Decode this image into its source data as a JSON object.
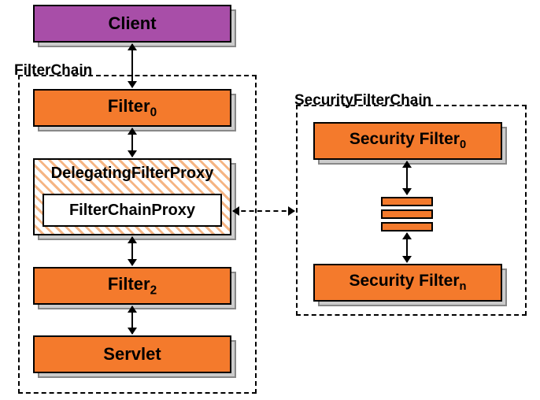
{
  "client": {
    "label": "Client"
  },
  "filterChain": {
    "label": "FilterChain",
    "filter0": "Filter",
    "filter0_sub": "0",
    "delegating": "DelegatingFilterProxy",
    "proxy": "FilterChainProxy",
    "filter2": "Filter",
    "filter2_sub": "2",
    "servlet": "Servlet"
  },
  "securityChain": {
    "label": "SecurityFilterChain",
    "sf0": "Security Filter",
    "sf0_sub": "0",
    "sfn": "Security Filter",
    "sfn_sub": "n"
  }
}
